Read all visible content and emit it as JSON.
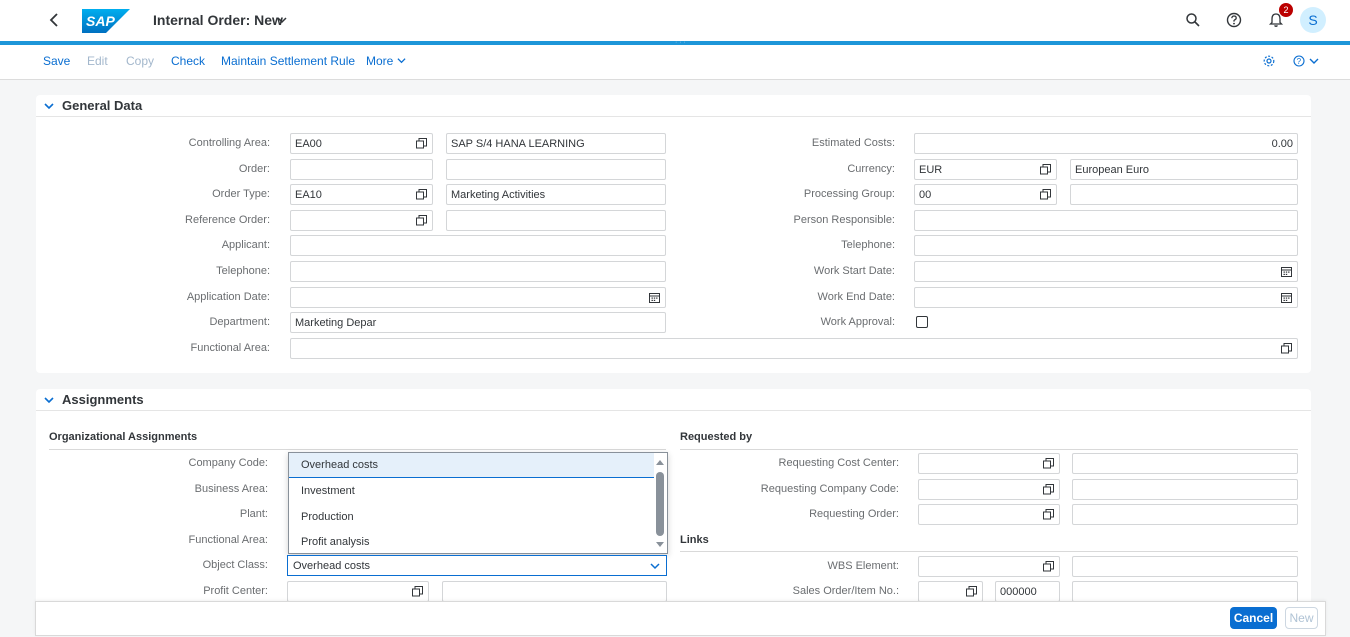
{
  "shell": {
    "title": "Internal Order: New",
    "notification_count": "2",
    "avatar_initial": "S",
    "logo_text": "SAP"
  },
  "toolbar": {
    "save": "Save",
    "edit": "Edit",
    "copy": "Copy",
    "check": "Check",
    "maintain_settlement_rule": "Maintain Settlement Rule",
    "more": "More"
  },
  "general_data": {
    "title": "General Data",
    "left": [
      {
        "label": "Controlling Area:",
        "value": "EA00",
        "desc": "SAP S/4 HANA LEARNING"
      },
      {
        "label": "Order:",
        "value": "",
        "desc": ""
      },
      {
        "label": "Order Type:",
        "value": "EA10",
        "desc": "Marketing Activities"
      },
      {
        "label": "Reference Order:",
        "value": "",
        "desc": ""
      },
      {
        "label": "Applicant:",
        "value": ""
      },
      {
        "label": "Telephone:",
        "value": ""
      },
      {
        "label": "Application Date:",
        "value": ""
      },
      {
        "label": "Department:",
        "value": "Marketing Depar"
      },
      {
        "label": "Functional Area:",
        "value": ""
      }
    ],
    "right": [
      {
        "label": "Estimated Costs:",
        "value": "0.00"
      },
      {
        "label": "Currency:",
        "value": "EUR",
        "desc": "European Euro"
      },
      {
        "label": "Processing Group:",
        "value": "00",
        "desc": ""
      },
      {
        "label": "Person Responsible:",
        "value": ""
      },
      {
        "label": "Telephone:",
        "value": ""
      },
      {
        "label": "Work Start Date:",
        "value": ""
      },
      {
        "label": "Work End Date:",
        "value": ""
      },
      {
        "label": "Work Approval:",
        "checked": false
      }
    ]
  },
  "assignments": {
    "title": "Assignments",
    "org_title": "Organizational Assignments",
    "org": [
      {
        "label": "Company Code:"
      },
      {
        "label": "Business Area:"
      },
      {
        "label": "Plant:"
      },
      {
        "label": "Functional Area:"
      },
      {
        "label": "Object Class:",
        "value": "Overhead costs"
      },
      {
        "label": "Profit Center:",
        "value": "",
        "desc": ""
      }
    ],
    "object_class_options": [
      "Overhead costs",
      "Investment",
      "Production",
      "Profit analysis"
    ],
    "object_class_selected_index": 0,
    "requested_title": "Requested by",
    "requested": [
      {
        "label": "Requesting Cost Center:",
        "value": "",
        "desc": ""
      },
      {
        "label": "Requesting Company Code:",
        "value": "",
        "desc": ""
      },
      {
        "label": "Requesting Order:",
        "value": "",
        "desc": ""
      }
    ],
    "links_title": "Links",
    "links": [
      {
        "label": "WBS Element:",
        "value": "",
        "desc": ""
      },
      {
        "label": "Sales Order/Item No.:",
        "value": "",
        "item": "000000",
        "desc": ""
      }
    ]
  },
  "footer": {
    "cancel": "Cancel",
    "new": "New"
  },
  "colors": {
    "brand_blue": "#0a6ed1",
    "shell_accent": "#1d96d9",
    "badge_red": "#bb0000"
  }
}
